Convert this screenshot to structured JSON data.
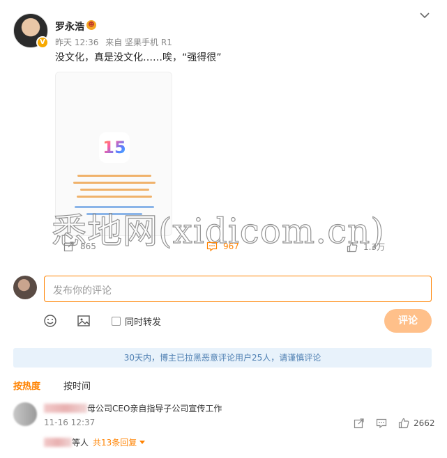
{
  "post": {
    "author": "罗永浩",
    "time": "昨天 12:36",
    "source": "来自 坚果手机 R1",
    "text": "没文化，真是没文化……唉，“强得很”",
    "image_label": "15",
    "stats": {
      "shares": "865",
      "comments": "967",
      "likes": "1.3万"
    }
  },
  "watermark": "悉地网(xidicom.cn)",
  "composer": {
    "placeholder": "发布你的评论",
    "repost_label": "同时转发",
    "submit_label": "评论"
  },
  "notice": "30天内，博主已拉黑恶意评论用户25人，请谨慎评论",
  "sort": {
    "hot": "按热度",
    "time": "按时间"
  },
  "comment": {
    "text": "母公司CEO亲自指导子公司宣传工作",
    "time": "11-16 12:37",
    "likes": "2662",
    "reply_suffix": "等人",
    "reply_count": "共13条回复"
  },
  "colors": {
    "accent": "#ff8200",
    "notice_bg": "#e8f2fb",
    "notice_text": "#4e7fb2"
  }
}
